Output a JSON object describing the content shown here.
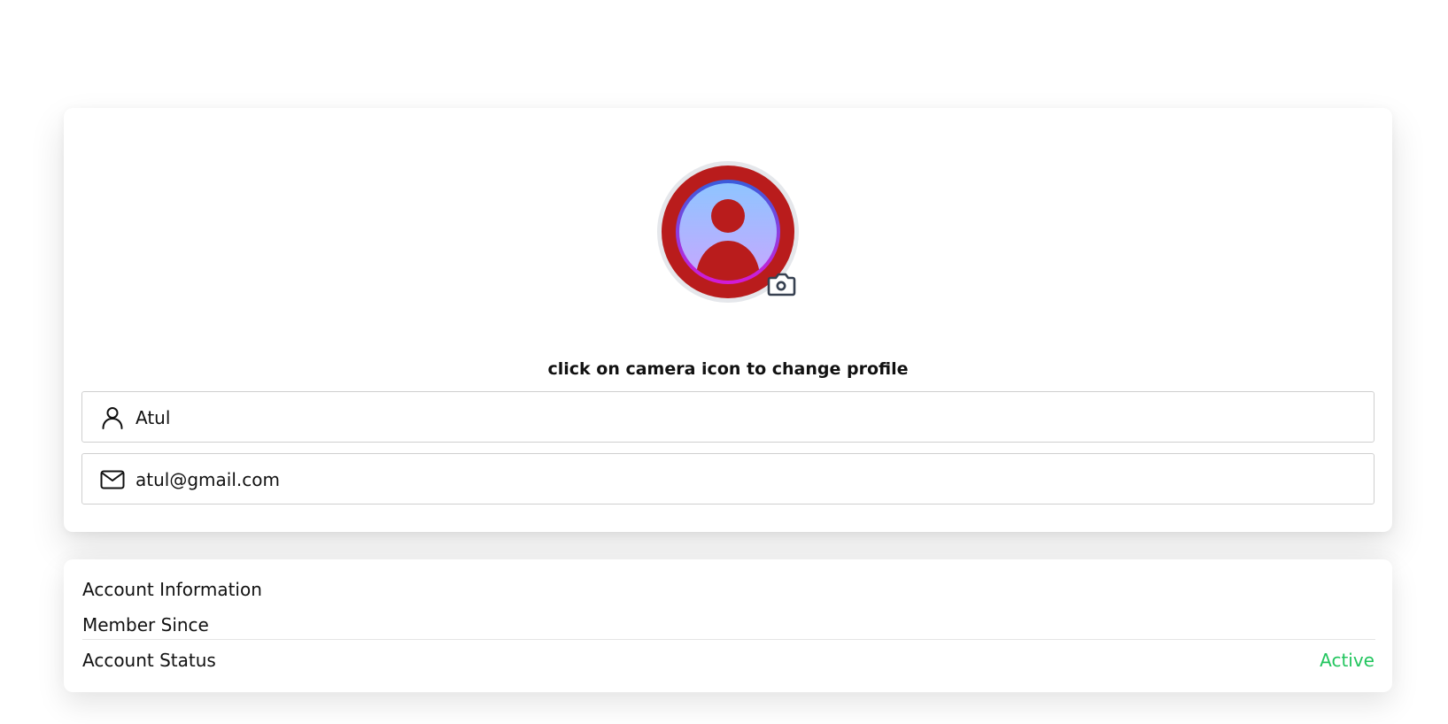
{
  "profile": {
    "hint": "click on camera icon to change profile",
    "avatar_icon": "user-avatar-icon",
    "camera_icon": "camera-icon",
    "colors": {
      "avatar_bg": "#b91c1c",
      "avatar_ring": "#e5e7eb",
      "gradient_top": "#93c5fd",
      "gradient_bottom": "#c084fc",
      "ring_blue": "#3b5bdb",
      "ring_magenta": "#c026d3"
    }
  },
  "fields": {
    "name": {
      "icon": "user-icon",
      "value": "Atul"
    },
    "email": {
      "icon": "mail-icon",
      "value": "atul@gmail.com"
    }
  },
  "account": {
    "title": "Account Information",
    "member_since_label": "Member Since",
    "status_label": "Account Status",
    "status_value": "Active",
    "status_color": "#22c55e"
  }
}
